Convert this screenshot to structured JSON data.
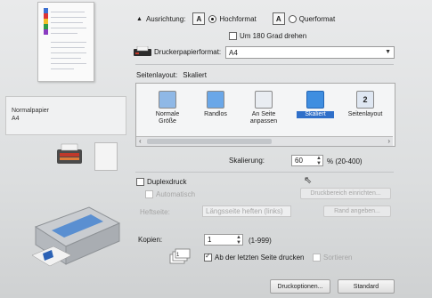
{
  "media": {
    "type": "Normalpapier",
    "size": "A4"
  },
  "orientation": {
    "label": "Ausrichtung:",
    "portrait": "Hochformat",
    "landscape": "Querformat",
    "rotate180": "Um 180 Grad drehen"
  },
  "paper_size": {
    "label": "Druckerpapierformat:",
    "value": "A4"
  },
  "page_layout": {
    "label": "Seitenlayout:",
    "value": "Skaliert",
    "items": [
      {
        "label": "Normale Größe"
      },
      {
        "label": "Randlos"
      },
      {
        "label": "An Seite anpassen"
      },
      {
        "label": "Skaliert"
      },
      {
        "label": "Seitenlayout"
      }
    ],
    "selected": "Skaliert"
  },
  "scaling": {
    "label": "Skalierung:",
    "value": "60",
    "unit": "% (20-400)"
  },
  "duplex": {
    "label": "Duplexdruck",
    "auto": "Automatisch",
    "area_button": "Druckbereich einrichten...",
    "staple_label": "Heftseite:",
    "staple_value": "Längsseite heften (links)",
    "margin_button": "Rand angeben..."
  },
  "copies": {
    "label": "Kopien:",
    "value": "1",
    "range": "(1-999)",
    "reverse_label": "Ab der letzten Seite drucken",
    "collate_label": "Sortieren"
  },
  "buttons": {
    "options": "Druckoptionen...",
    "default": "Standard"
  }
}
